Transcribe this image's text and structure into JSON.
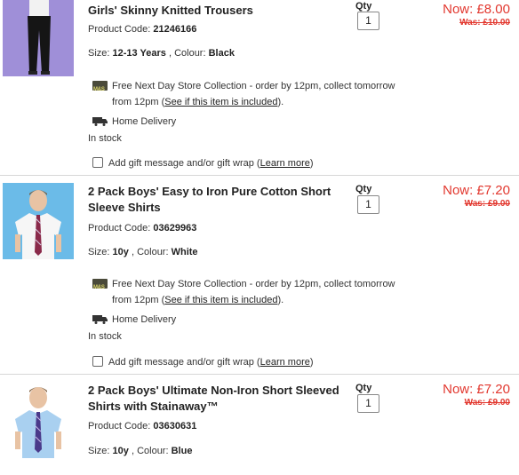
{
  "items": [
    {
      "title": "Girls' Skinny Knitted Trousers",
      "code_label": "Product Code:",
      "code": "21246166",
      "size_label": "Size:",
      "size": "12-13 Years",
      "colour_label": ", Colour:",
      "colour": "Black",
      "qty_label": "Qty",
      "qty": "1",
      "now": "Now: £8.00",
      "was": "Was: £10.00",
      "store_text": "Free Next Day Store Collection - order by 12pm, collect tomorrow",
      "store_text2_pre": "from 12pm (",
      "store_link": "See if this item is included",
      "store_text2_post": ").",
      "home_delivery": "Home Delivery",
      "stock": "In stock",
      "gift_text": "Add gift message and/or gift wrap (",
      "gift_link": "Learn more",
      "gift_close": ")"
    },
    {
      "title": "2 Pack Boys' Easy to Iron Pure Cotton Short Sleeve Shirts",
      "code_label": "Product Code:",
      "code": "03629963",
      "size_label": "Size:",
      "size": "10y",
      "colour_label": ", Colour:",
      "colour": "White",
      "qty_label": "Qty",
      "qty": "1",
      "now": "Now: £7.20",
      "was": "Was: £9.00",
      "store_text": "Free Next Day Store Collection - order by 12pm, collect tomorrow",
      "store_text2_pre": "from 12pm (",
      "store_link": "See if this item is included",
      "store_text2_post": ").",
      "home_delivery": "Home Delivery",
      "stock": "In stock",
      "gift_text": "Add gift message and/or gift wrap (",
      "gift_link": "Learn more",
      "gift_close": ")"
    },
    {
      "title": "2 Pack Boys' Ultimate Non-Iron Short Sleeved Shirts with Stainaway™",
      "code_label": "Product Code:",
      "code": "03630631",
      "size_label": "Size:",
      "size": "10y",
      "colour_label": ", Colour:",
      "colour": "Blue",
      "qty_label": "Qty",
      "qty": "1",
      "now": "Now: £7.20",
      "was": "Was: £9.00"
    }
  ],
  "colors": {
    "price_red": "#e2382f",
    "divider": "#d7d7d7"
  }
}
